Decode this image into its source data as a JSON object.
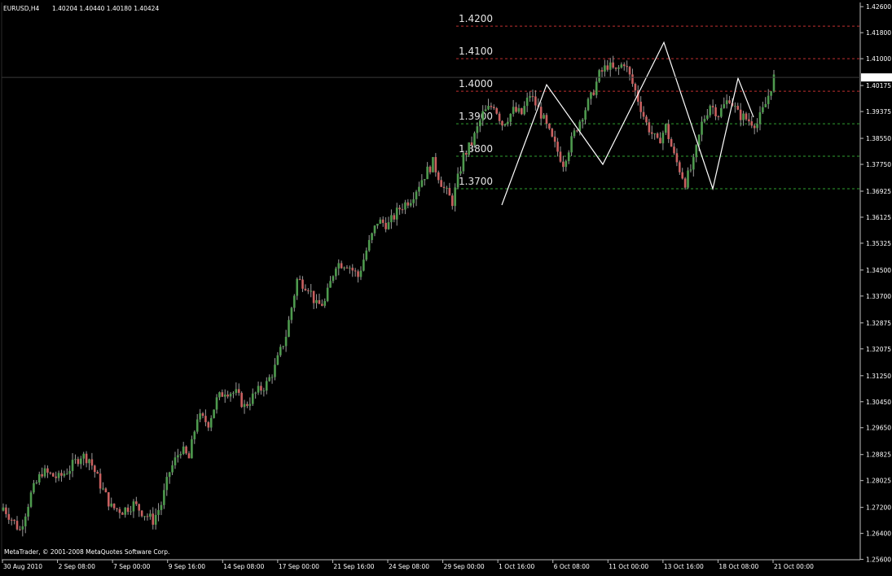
{
  "header": {
    "symbol": "EURUSD,H4",
    "ohlc": "1.40204 1.40440 1.40180 1.40424"
  },
  "footer": {
    "copyright": "MetaTrader, © 2001-2008 MetaQuotes Software Corp."
  },
  "colors": {
    "background": "#000000",
    "axis": "#c0c0c0",
    "bull_candle": "#4e9a4e",
    "bear_candle": "#c96060",
    "wick": "#9a9a9a",
    "grid": "#5a5a5a",
    "zigzag": "#ffffff",
    "resistance": "#c03030",
    "support": "#30a030",
    "current_price_bg": "#ffffff"
  },
  "chart_data": {
    "type": "candlestick",
    "symbol": "EURUSD",
    "timeframe": "H4",
    "ylim": [
      1.2559,
      1.4273
    ],
    "y_ticks": [
      "1.42600",
      "1.41800",
      "1.41000",
      "1.40175",
      "1.39375",
      "1.38550",
      "1.37750",
      "1.36925",
      "1.36125",
      "1.35325",
      "1.34500",
      "1.33700",
      "1.32875",
      "1.32075",
      "1.31250",
      "1.30450",
      "1.29650",
      "1.28825",
      "1.28025",
      "1.27200",
      "1.26400",
      "1.25600"
    ],
    "x_ticks": [
      "30 Aug 2010",
      "2 Sep 08:00",
      "7 Sep 00:00",
      "9 Sep 16:00",
      "14 Sep 08:00",
      "17 Sep 00:00",
      "21 Sep 16:00",
      "24 Sep 08:00",
      "29 Sep 00:00",
      "1 Oct 16:00",
      "6 Oct 08:00",
      "11 Oct 00:00",
      "13 Oct 16:00",
      "18 Oct 08:00",
      "21 Oct 00:00"
    ],
    "current_price": "1.40424",
    "horizontal_levels": [
      {
        "label": "1.4200",
        "value": 1.42,
        "kind": "resistance"
      },
      {
        "label": "1.4100",
        "value": 1.41,
        "kind": "resistance"
      },
      {
        "label": "1.4000",
        "value": 1.4,
        "kind": "resistance"
      },
      {
        "label": "1.3900",
        "value": 1.39,
        "kind": "support"
      },
      {
        "label": "1.3800",
        "value": 1.38,
        "kind": "support"
      },
      {
        "label": "1.3700",
        "value": 1.37,
        "kind": "support"
      }
    ],
    "anchors": [
      [
        0,
        1.272
      ],
      [
        6,
        1.265
      ],
      [
        10,
        1.276
      ],
      [
        14,
        1.283
      ],
      [
        20,
        1.281
      ],
      [
        24,
        1.284
      ],
      [
        28,
        1.288
      ],
      [
        31,
        1.287
      ],
      [
        35,
        1.279
      ],
      [
        39,
        1.272
      ],
      [
        43,
        1.271
      ],
      [
        47,
        1.273
      ],
      [
        51,
        1.27
      ],
      [
        54,
        1.268
      ],
      [
        57,
        1.273
      ],
      [
        60,
        1.283
      ],
      [
        64,
        1.29
      ],
      [
        67,
        1.287
      ],
      [
        70,
        1.3
      ],
      [
        74,
        1.298
      ],
      [
        77,
        1.305
      ],
      [
        80,
        1.308
      ],
      [
        84,
        1.307
      ],
      [
        87,
        1.303
      ],
      [
        91,
        1.307
      ],
      [
        95,
        1.31
      ],
      [
        98,
        1.315
      ],
      [
        102,
        1.325
      ],
      [
        106,
        1.342
      ],
      [
        110,
        1.34
      ],
      [
        113,
        1.334
      ],
      [
        116,
        1.335
      ],
      [
        120,
        1.347
      ],
      [
        124,
        1.347
      ],
      [
        128,
        1.343
      ],
      [
        131,
        1.351
      ],
      [
        135,
        1.36
      ],
      [
        139,
        1.359
      ],
      [
        143,
        1.364
      ],
      [
        147,
        1.367
      ],
      [
        151,
        1.373
      ],
      [
        155,
        1.378
      ],
      [
        159,
        1.37
      ],
      [
        162,
        1.366
      ],
      [
        166,
        1.38
      ],
      [
        169,
        1.384
      ],
      [
        173,
        1.393
      ],
      [
        177,
        1.396
      ],
      [
        180,
        1.39
      ],
      [
        184,
        1.394
      ],
      [
        187,
        1.393
      ],
      [
        190,
        1.399
      ],
      [
        194,
        1.393
      ],
      [
        198,
        1.385
      ],
      [
        202,
        1.378
      ],
      [
        206,
        1.387
      ],
      [
        209,
        1.393
      ],
      [
        212,
        1.398
      ],
      [
        215,
        1.405
      ],
      [
        218,
        1.408
      ],
      [
        221,
        1.406
      ],
      [
        224,
        1.409
      ],
      [
        228,
        1.4
      ],
      [
        232,
        1.39
      ],
      [
        236,
        1.384
      ],
      [
        239,
        1.389
      ],
      [
        242,
        1.38
      ],
      [
        246,
        1.372
      ],
      [
        249,
        1.378
      ],
      [
        252,
        1.39
      ],
      [
        255,
        1.396
      ],
      [
        258,
        1.393
      ],
      [
        262,
        1.398
      ],
      [
        265,
        1.393
      ],
      [
        269,
        1.391
      ],
      [
        272,
        1.39
      ],
      [
        275,
        1.396
      ],
      [
        278,
        1.4042
      ]
    ],
    "zigzag": [
      [
        1.365,
        "1 Oct"
      ],
      [
        1.402,
        "5 Oct"
      ],
      [
        1.3775,
        "8 Oct"
      ],
      [
        1.415,
        "13 Oct"
      ],
      [
        1.37,
        "19 Oct"
      ],
      [
        1.404,
        "20 Oct"
      ],
      [
        1.392,
        "21 Oct"
      ]
    ]
  }
}
